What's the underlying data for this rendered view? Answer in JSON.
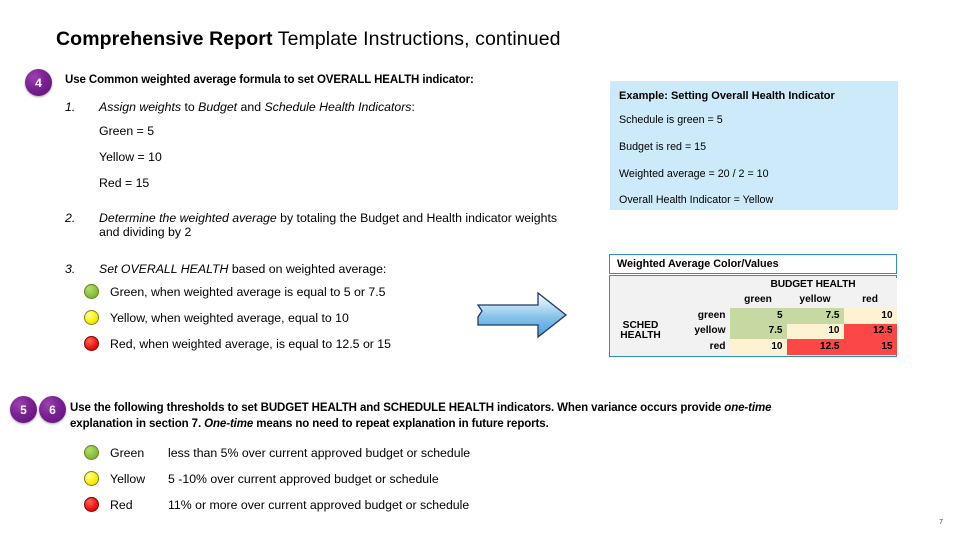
{
  "slide": {
    "title_bold": "Comprehensive Report",
    "title_rest": " Template Instructions, continued",
    "page_number": "7"
  },
  "step4": {
    "badge": "4",
    "heading": "Use Common weighted average formula to set OVERALL HEALTH indicator:",
    "item1": {
      "number": "1.",
      "part_a": "Assign weights",
      "part_b": " to ",
      "part_c": "Budget",
      "part_d": " and ",
      "part_e": "Schedule Health Indicators",
      "part_f": ":"
    },
    "weights": [
      "Green = 5",
      "Yellow = 10",
      "Red = 15"
    ],
    "item2": {
      "number": "2.",
      "part_a": "Determine the weighted average",
      "part_b": " by totaling the Budget and Health indicator weights and dividing by 2"
    },
    "item3": {
      "number": "3.",
      "part_a": "Set OVERALL HEALTH",
      "part_b": " based on weighted average:"
    },
    "thresholds": [
      {
        "color": "green",
        "text": "Green, when weighted average is equal to 5 or 7.5"
      },
      {
        "color": "yellow",
        "text": "Yellow, when weighted average, equal to 10"
      },
      {
        "color": "red",
        "text": "Red, when weighted average, is equal to 12.5 or 15"
      }
    ]
  },
  "example_box": {
    "title": "Example: Setting Overall Health Indicator",
    "lines": [
      "Schedule is green = 5",
      "Budget is red = 15",
      "Weighted average = 20 / 2 = 10",
      "Overall Health Indicator = Yellow"
    ]
  },
  "weighted_average_table": {
    "title": "Weighted Average Color/Values",
    "col_group_header": "BUDGET HEALTH",
    "row_group_header_line1": "SCHED",
    "row_group_header_line2": "HEALTH",
    "columns": [
      "green",
      "yellow",
      "red"
    ],
    "rows": [
      {
        "label": "green",
        "values": [
          "5",
          "7.5",
          "10"
        ],
        "cell_colors": [
          "green",
          "green",
          "cream"
        ]
      },
      {
        "label": "yellow",
        "values": [
          "7.5",
          "10",
          "12.5"
        ],
        "cell_colors": [
          "green",
          "cream",
          "red"
        ]
      },
      {
        "label": "red",
        "values": [
          "10",
          "12.5",
          "15"
        ],
        "cell_colors": [
          "cream",
          "red",
          "red"
        ]
      }
    ],
    "colors": {
      "green": "#c6d9a3",
      "cream": "#fdf3d3",
      "red": "#fc4747",
      "border": "#2b8fc4"
    }
  },
  "step56": {
    "badge_a": "5",
    "badge_b": "6",
    "para_a": "Use the following thresholds to set BUDGET HEALTH and SCHEDULE HEALTH indicators.  When variance occurs provide ",
    "para_a_italic": "one-time",
    "para_b": "explanation in section 7.  ",
    "para_b_italic": "One-time",
    "para_b_tail": " means no need to repeat explanation in future reports.",
    "thresholds": [
      {
        "color": "green",
        "label": "Green",
        "text": "less than 5% over current approved budget or schedule"
      },
      {
        "color": "yellow",
        "label": "Yellow",
        "text": "5 -10% over current approved budget or schedule"
      },
      {
        "color": "red",
        "label": "Red",
        "text": "11% or more over current approved budget or schedule"
      }
    ]
  }
}
